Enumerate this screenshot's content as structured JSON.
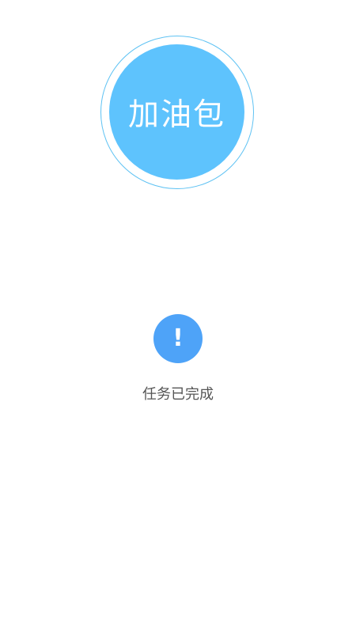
{
  "badge": {
    "label": "加油包",
    "fill_color": "#5ec3fd",
    "ring_color": "#5ec2f3"
  },
  "status": {
    "icon": "exclamation-icon",
    "icon_glyph": "!",
    "icon_color": "#4ea3f8",
    "message": "任务已完成"
  }
}
